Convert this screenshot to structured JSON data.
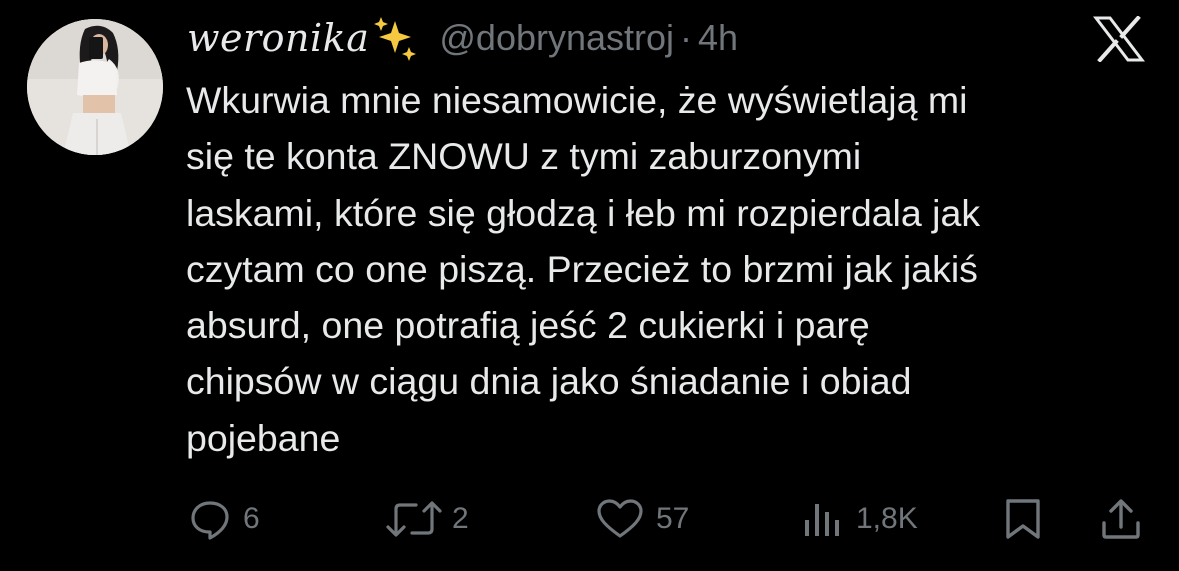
{
  "tweet": {
    "display_name": "weronika",
    "display_name_emoji": "sparkles-icon",
    "handle": "@dobrynastroj",
    "separator": "·",
    "time": "4h",
    "text": "Wkurwia mnie niesamowicie, że wyświetlają mi\nsię te konta ZNOWU z tymi zaburzonymi\nlaskami, które się głodzą i łeb mi rozpierdala jak\nczytam co one piszą. Przecież to brzmi jak jakiś\nabsurd, one potrafią jeść 2 cukierki i parę\nchipsów w ciągu dnia jako śniadanie i obiad\npojebane"
  },
  "actions": {
    "replies": "6",
    "reposts": "2",
    "likes": "57",
    "views": "1,8K"
  },
  "icons": {
    "brand": "x-logo-icon",
    "reply": "reply-icon",
    "repost": "repost-icon",
    "like": "heart-icon",
    "views": "views-icon",
    "bookmark": "bookmark-icon",
    "share": "share-icon"
  },
  "colors": {
    "background": "#000000",
    "text": "#e7e9ea",
    "secondary": "#71767b",
    "sparkle": "#f5c842"
  }
}
